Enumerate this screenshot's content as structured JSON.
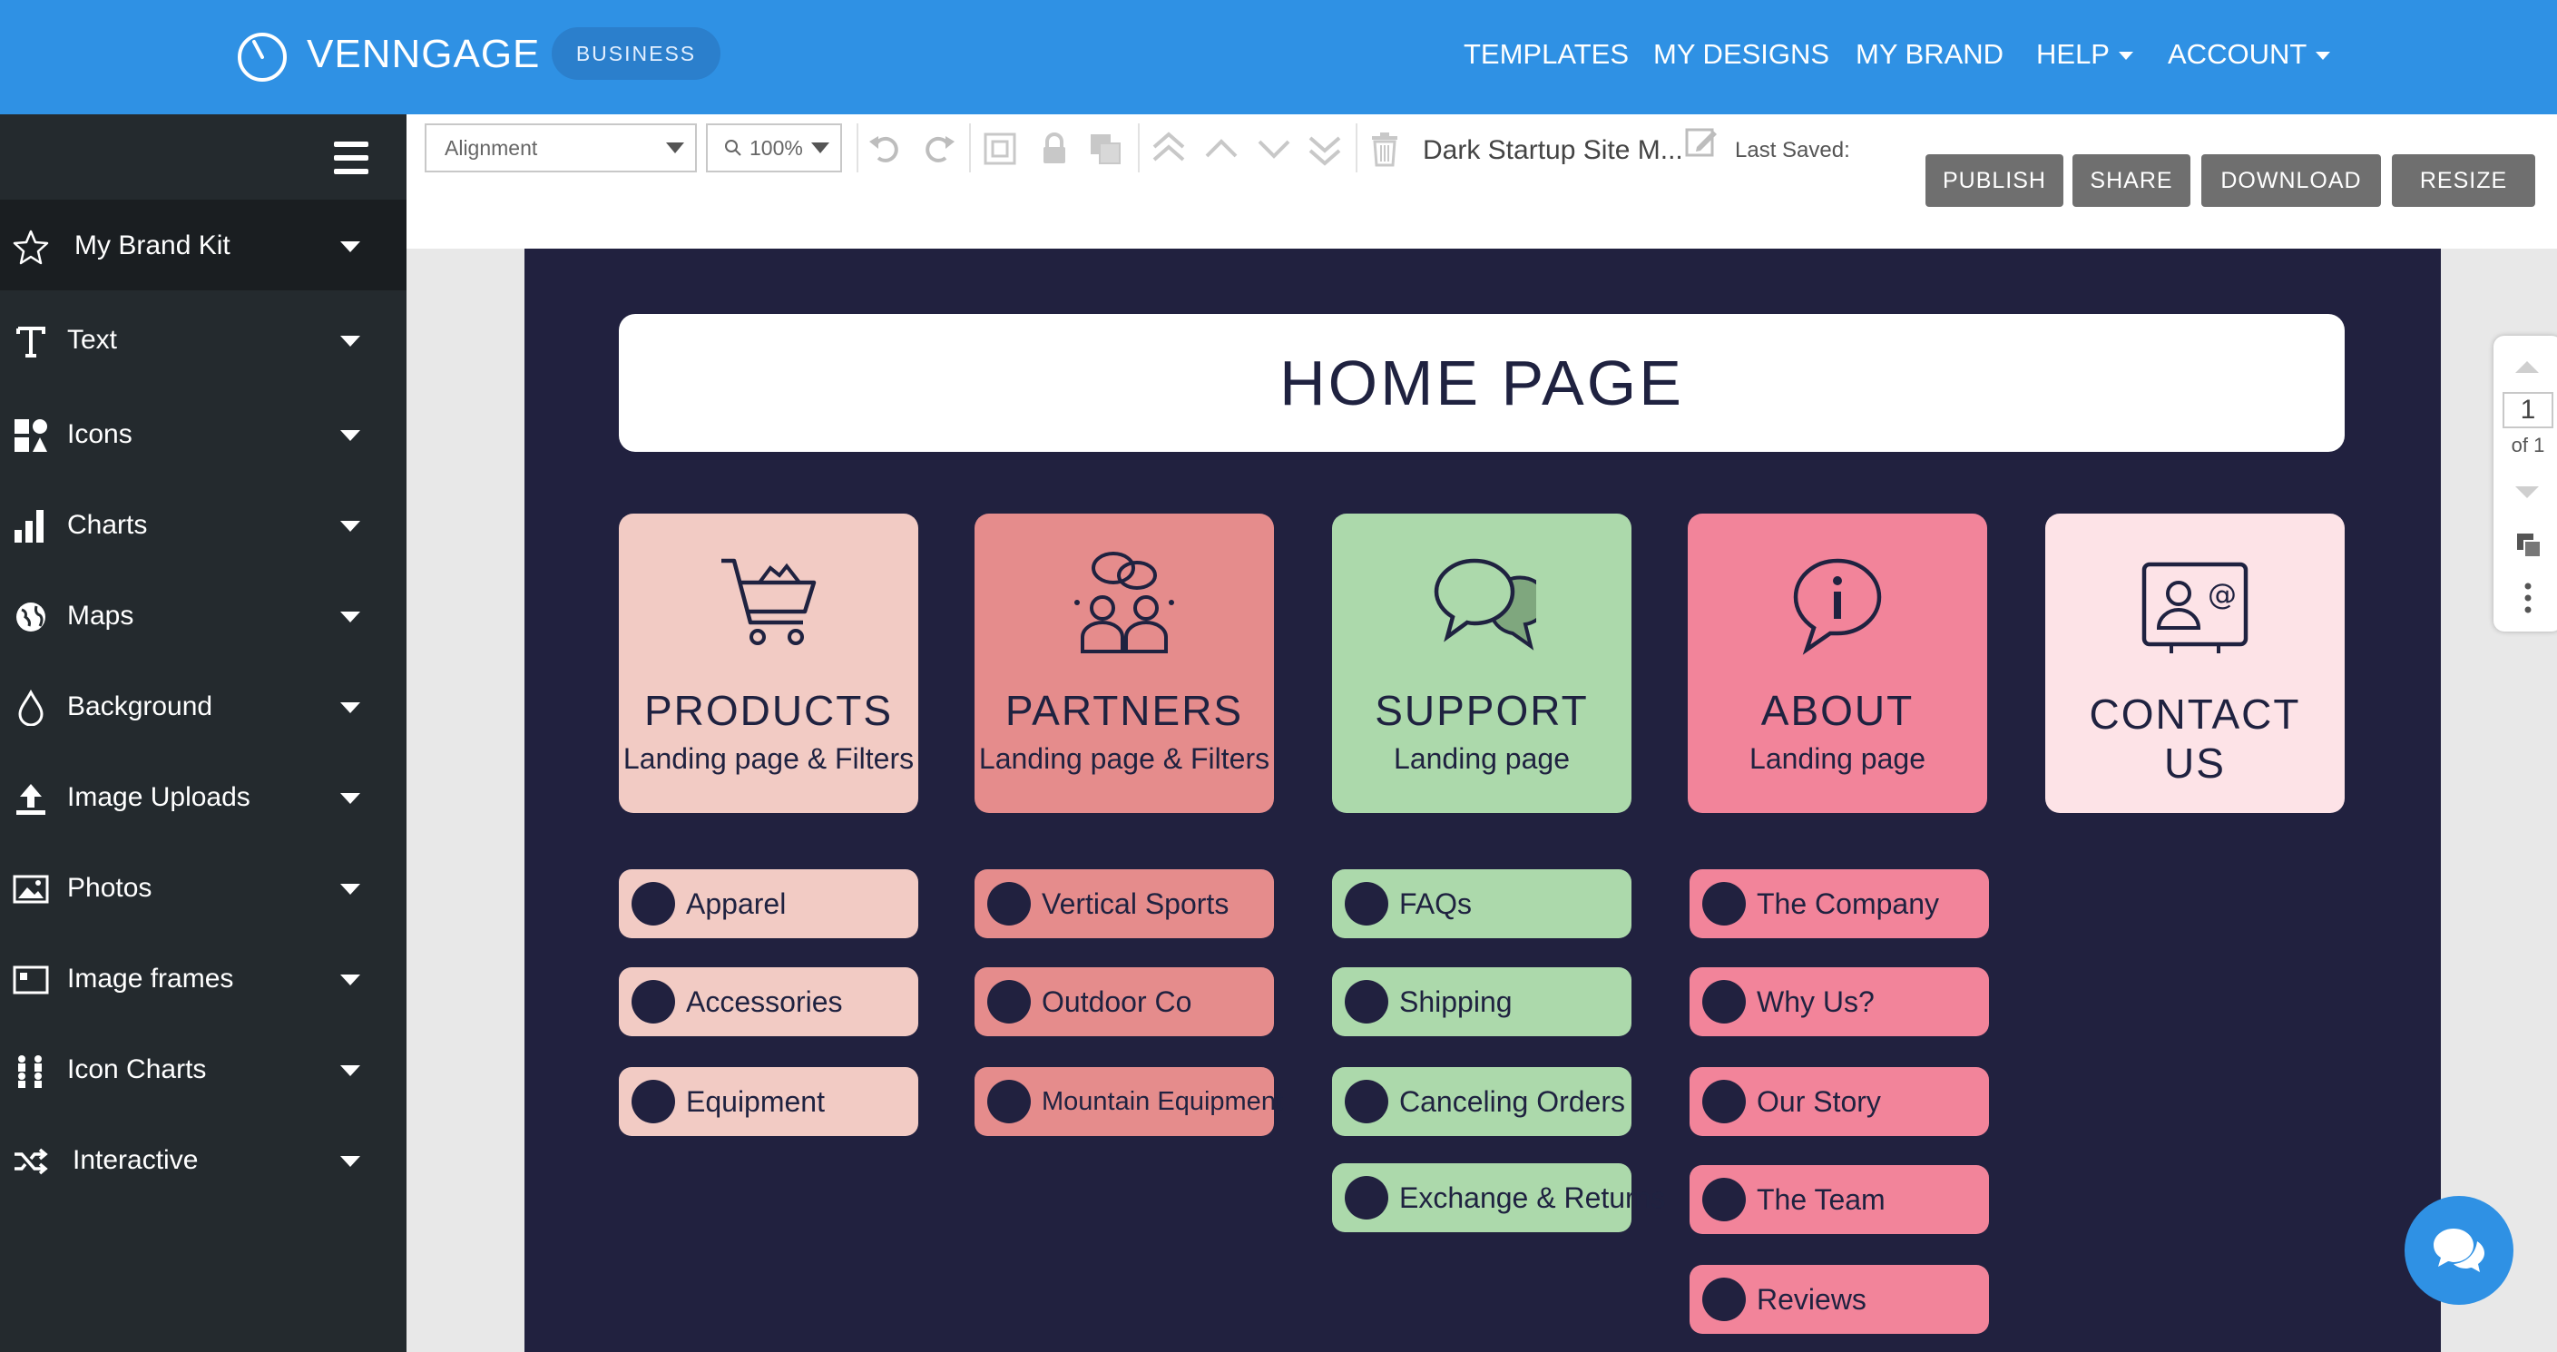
{
  "nav": {
    "brand": "VENNGAGE",
    "plan": "BUSINESS",
    "links": [
      "TEMPLATES",
      "MY DESIGNS",
      "MY BRAND",
      "HELP",
      "ACCOUNT"
    ],
    "brand_color": "#2f91e4"
  },
  "sidebar": {
    "items": [
      {
        "label": "My Brand Kit",
        "icon": "star-icon"
      },
      {
        "label": "Text",
        "icon": "text-icon"
      },
      {
        "label": "Icons",
        "icon": "icons-icon"
      },
      {
        "label": "Charts",
        "icon": "bar-chart-icon"
      },
      {
        "label": "Maps",
        "icon": "globe-icon"
      },
      {
        "label": "Background",
        "icon": "droplet-icon"
      },
      {
        "label": "Image Uploads",
        "icon": "upload-icon"
      },
      {
        "label": "Photos",
        "icon": "photo-icon"
      },
      {
        "label": "Image frames",
        "icon": "frame-icon"
      },
      {
        "label": "Icon Charts",
        "icon": "people-chart-icon"
      },
      {
        "label": "Interactive",
        "icon": "shuffle-icon"
      }
    ]
  },
  "toolbar": {
    "alignment": "Alignment",
    "zoom": "100%",
    "doc_title": "Dark Startup Site M...",
    "last_saved": "Last Saved:",
    "buttons": [
      "PUBLISH",
      "SHARE",
      "DOWNLOAD",
      "RESIZE"
    ]
  },
  "canvas": {
    "background": "#21213f",
    "hero_title": "HOME PAGE",
    "cards": [
      {
        "title": "PRODUCTS",
        "subtitle": "Landing page & Filters",
        "color": "#f2cbc4",
        "icon": "shopping-cart-icon"
      },
      {
        "title": "PARTNERS",
        "subtitle": "Landing page & Filters",
        "color": "#e58c8c",
        "icon": "partners-icon"
      },
      {
        "title": "SUPPORT",
        "subtitle": "Landing page",
        "color": "#acd9ab",
        "icon": "chat-bubbles-icon"
      },
      {
        "title": "ABOUT",
        "subtitle": "Landing page",
        "color": "#f2849a",
        "icon": "info-bubble-icon"
      },
      {
        "title": "CONTACT US",
        "subtitle": "",
        "color": "#fde3e7",
        "icon": "contact-card-icon"
      }
    ],
    "lists": [
      [
        "Apparel",
        "Accessories",
        "Equipment"
      ],
      [
        "Vertical Sports",
        "Outdoor Co",
        "Mountain Equipment"
      ],
      [
        "FAQs",
        "Shipping",
        "Canceling Orders",
        "Exchange & Returns"
      ],
      [
        "The Company",
        "Why Us?",
        "Our Story",
        "The Team",
        "Reviews"
      ]
    ]
  },
  "pager": {
    "current": "1",
    "of_label": "of 1"
  }
}
